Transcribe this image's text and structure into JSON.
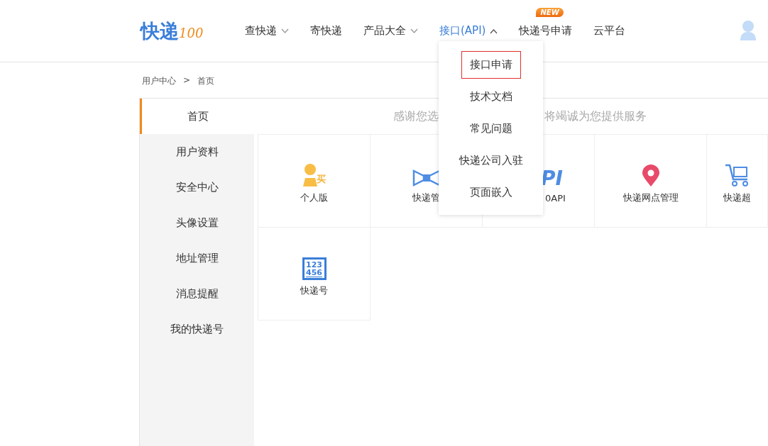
{
  "header": {
    "logo": {
      "main": "快递",
      "accent": "100"
    },
    "nav": [
      {
        "label": "查快递",
        "menu": {
          "expanded": false
        },
        "selected": false
      },
      {
        "label": "寄快递",
        "selected": false
      },
      {
        "label": "产品大全",
        "menu": {
          "expanded": false
        },
        "selected": false
      },
      {
        "label": "接口(API)",
        "menu": {
          "expanded": true
        },
        "selected": true
      },
      {
        "badge": "NEW",
        "label": "快递号申请",
        "selected": false
      },
      {
        "label": "云平台",
        "selected": false
      }
    ]
  },
  "dropdown": [
    {
      "label": "接口申请",
      "selected": true
    },
    {
      "label": "技术文档",
      "selected": false
    },
    {
      "label": "常见问题",
      "selected": false
    },
    {
      "label": "快递公司入驻",
      "selected": false
    },
    {
      "label": "页面嵌入",
      "selected": false
    }
  ],
  "breadcrumb": {
    "items": [
      "用户中心",
      "首页"
    ],
    "separator": ">"
  },
  "sidebar": [
    {
      "label": "首页",
      "selected": true
    },
    {
      "label": "用户资料",
      "selected": false
    },
    {
      "label": "安全中心",
      "selected": false
    },
    {
      "label": "头像设置",
      "selected": false
    },
    {
      "label": "地址管理",
      "selected": false
    },
    {
      "label": "消息提醒",
      "selected": false
    },
    {
      "label": "我的快递号",
      "selected": false
    }
  ],
  "banner": {
    "before": "感谢您选",
    "after": "将竭诚为您提供服务"
  },
  "cards": [
    {
      "kind": "person",
      "label": "个人版",
      "mark": "买"
    },
    {
      "kind": "bow",
      "label": "快递管"
    },
    {
      "kind": "api",
      "label": "0API",
      "mark": "PI"
    },
    {
      "kind": "pin",
      "label": "快递网点管理"
    },
    {
      "kind": "cart",
      "label": "快递超"
    },
    {
      "kind": "number",
      "label": "快递号",
      "mark": "123",
      "mark2": "456"
    }
  ]
}
